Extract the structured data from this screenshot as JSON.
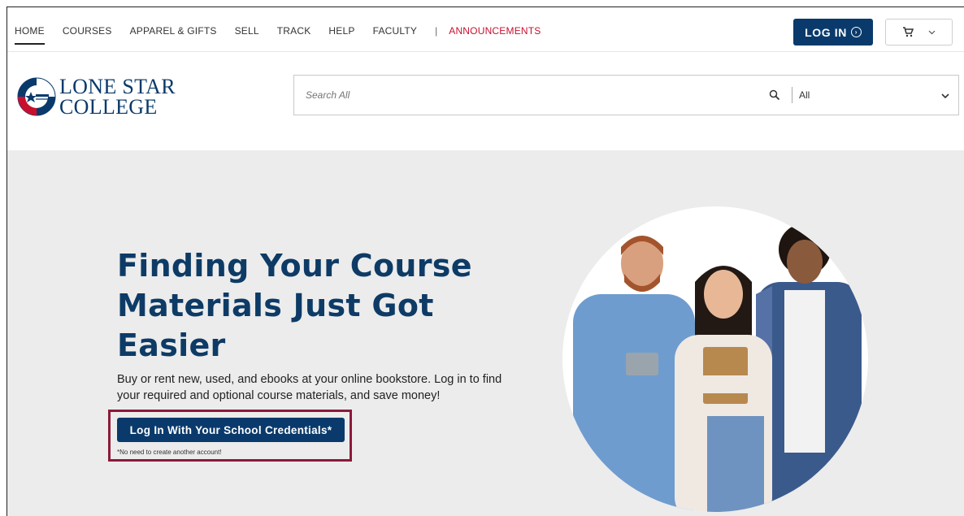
{
  "nav": {
    "items": [
      {
        "label": "HOME",
        "active": true
      },
      {
        "label": "COURSES"
      },
      {
        "label": "APPAREL & GIFTS"
      },
      {
        "label": "SELL"
      },
      {
        "label": "TRACK"
      },
      {
        "label": "HELP"
      },
      {
        "label": "FACULTY"
      }
    ],
    "separator": "|",
    "announcements": "ANNOUNCEMENTS",
    "login_label": "LOG IN",
    "cart_icon": "cart-icon",
    "cart_menu_icon": "chevron-down-icon"
  },
  "logo": {
    "line1": "Lone Star",
    "line2": "College",
    "badge": "Lone Star College"
  },
  "search": {
    "placeholder": "Search All",
    "category": "All"
  },
  "hero": {
    "headline": "Finding Your Course Materials Just Got Easier",
    "description": "Buy or rent new, used, and ebooks at your online bookstore. Log in to find your required and optional course materials, and save money!",
    "cta_label": "Log In With Your School Credentials*",
    "cta_note": "*No need to create another account!"
  },
  "colors": {
    "brand_navy": "#0a3a6b",
    "headline_navy": "#0d3b66",
    "accent_red": "#c8102e",
    "highlight_maroon": "#8b1a3a",
    "hero_bg": "#ececec"
  }
}
